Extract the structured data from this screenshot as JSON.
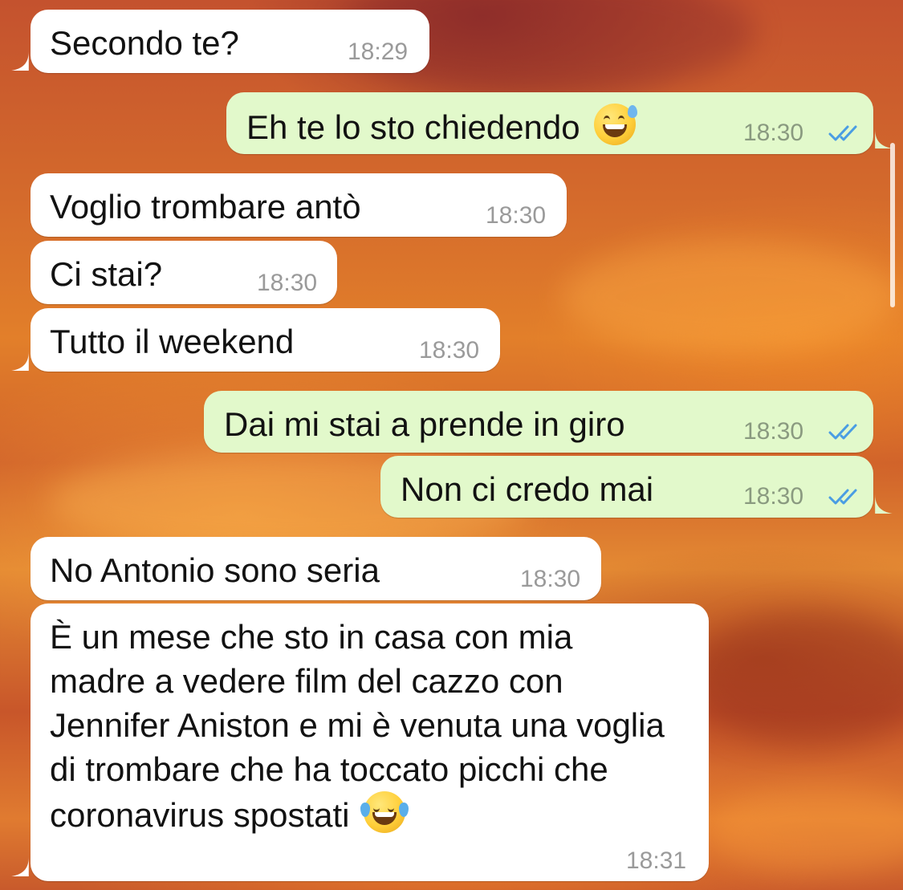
{
  "chat": {
    "messages": [
      {
        "direction": "incoming",
        "text": "Secondo te?",
        "time": "18:29"
      },
      {
        "direction": "outgoing",
        "text": "Eh te lo sto chiedendo",
        "emoji": "grinning-face-with-sweat-emoji",
        "time": "18:30",
        "status": "read"
      },
      {
        "direction": "incoming",
        "text": "Voglio trombare antò",
        "time": "18:30"
      },
      {
        "direction": "incoming",
        "text": "Ci stai?",
        "time": "18:30"
      },
      {
        "direction": "incoming",
        "text": "Tutto il weekend",
        "time": "18:30"
      },
      {
        "direction": "outgoing",
        "text": "Dai mi stai a prende in giro",
        "time": "18:30",
        "status": "read"
      },
      {
        "direction": "outgoing",
        "text": "Non ci credo mai",
        "time": "18:30",
        "status": "read"
      },
      {
        "direction": "incoming",
        "text": "No Antonio sono seria",
        "time": "18:30"
      },
      {
        "direction": "incoming",
        "text": "È un mese che sto in casa con mia madre a vedere film del cazzo con Jennifer Aniston e mi è venuta una voglia di trombare che ha toccato picchi che coronavirus spostati",
        "emoji": "face-with-tears-of-joy-emoji",
        "time": "18:31"
      }
    ]
  },
  "colors": {
    "incoming_bubble": "#ffffff",
    "outgoing_bubble": "#e2f9cb",
    "read_ticks": "#4a9de3",
    "timestamp": "#9a9a9a",
    "message_text": "#121212",
    "wallpaper": "#d8692c"
  }
}
